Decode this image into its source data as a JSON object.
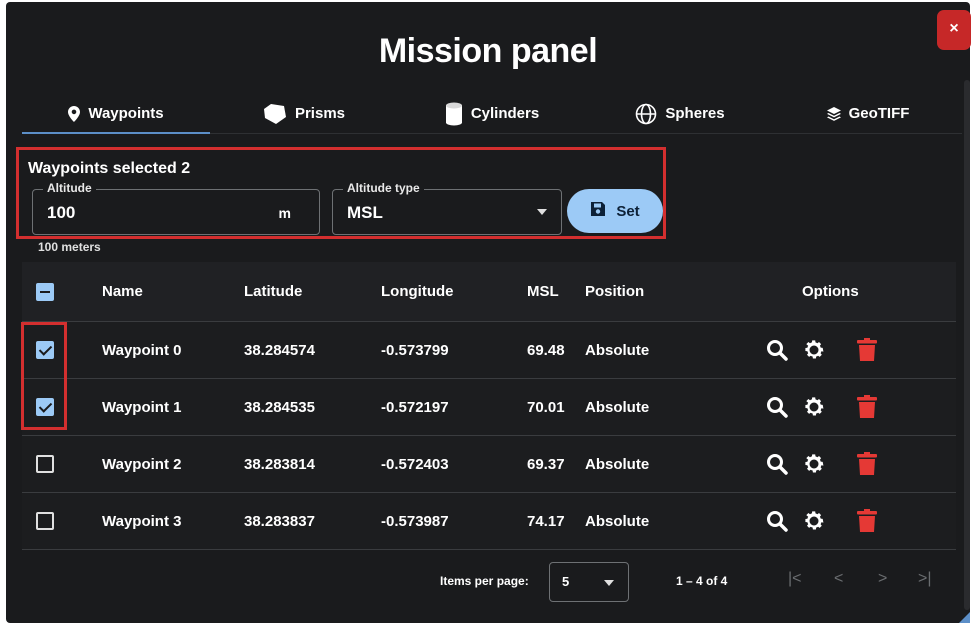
{
  "panel": {
    "title": "Mission panel",
    "close_label": "×"
  },
  "tabs": [
    {
      "label": "Waypoints",
      "icon": "map-pin-icon",
      "active": true
    },
    {
      "label": "Prisms",
      "icon": "pentagon-icon",
      "active": false
    },
    {
      "label": "Cylinders",
      "icon": "cylinder-icon",
      "active": false
    },
    {
      "label": "Spheres",
      "icon": "globe-icon",
      "active": false
    },
    {
      "label": "GeoTIFF",
      "icon": "layers-icon",
      "active": false
    }
  ],
  "selection": {
    "label": "Waypoints selected 2",
    "altitude_legend": "Altitude",
    "altitude_value": "100",
    "altitude_unit": "m",
    "altitude_helper": "100 meters",
    "type_legend": "Altitude type",
    "type_value": "MSL",
    "set_label": "Set"
  },
  "table": {
    "headers": {
      "name": "Name",
      "latitude": "Latitude",
      "longitude": "Longitude",
      "msl": "MSL",
      "position": "Position",
      "options": "Options"
    },
    "rows": [
      {
        "checked": true,
        "name": "Waypoint 0",
        "latitude": "38.284574",
        "longitude": "-0.573799",
        "msl": "69.48",
        "position": "Absolute"
      },
      {
        "checked": true,
        "name": "Waypoint 1",
        "latitude": "38.284535",
        "longitude": "-0.572197",
        "msl": "70.01",
        "position": "Absolute"
      },
      {
        "checked": false,
        "name": "Waypoint 2",
        "latitude": "38.283814",
        "longitude": "-0.572403",
        "msl": "69.37",
        "position": "Absolute"
      },
      {
        "checked": false,
        "name": "Waypoint 3",
        "latitude": "38.283837",
        "longitude": "-0.573987",
        "msl": "74.17",
        "position": "Absolute"
      }
    ]
  },
  "pager": {
    "items_label": "Items per page:",
    "items_value": "5",
    "range": "1 – 4 of 4",
    "first_icon": "first-page-icon",
    "prev_icon": "chevron-left-icon",
    "next_icon": "chevron-right-icon",
    "last_icon": "last-page-icon"
  },
  "colors": {
    "background": "#1a1b1d",
    "accent": "#9ccaf6",
    "delete": "#e53935",
    "highlight": "#d32f2f"
  }
}
